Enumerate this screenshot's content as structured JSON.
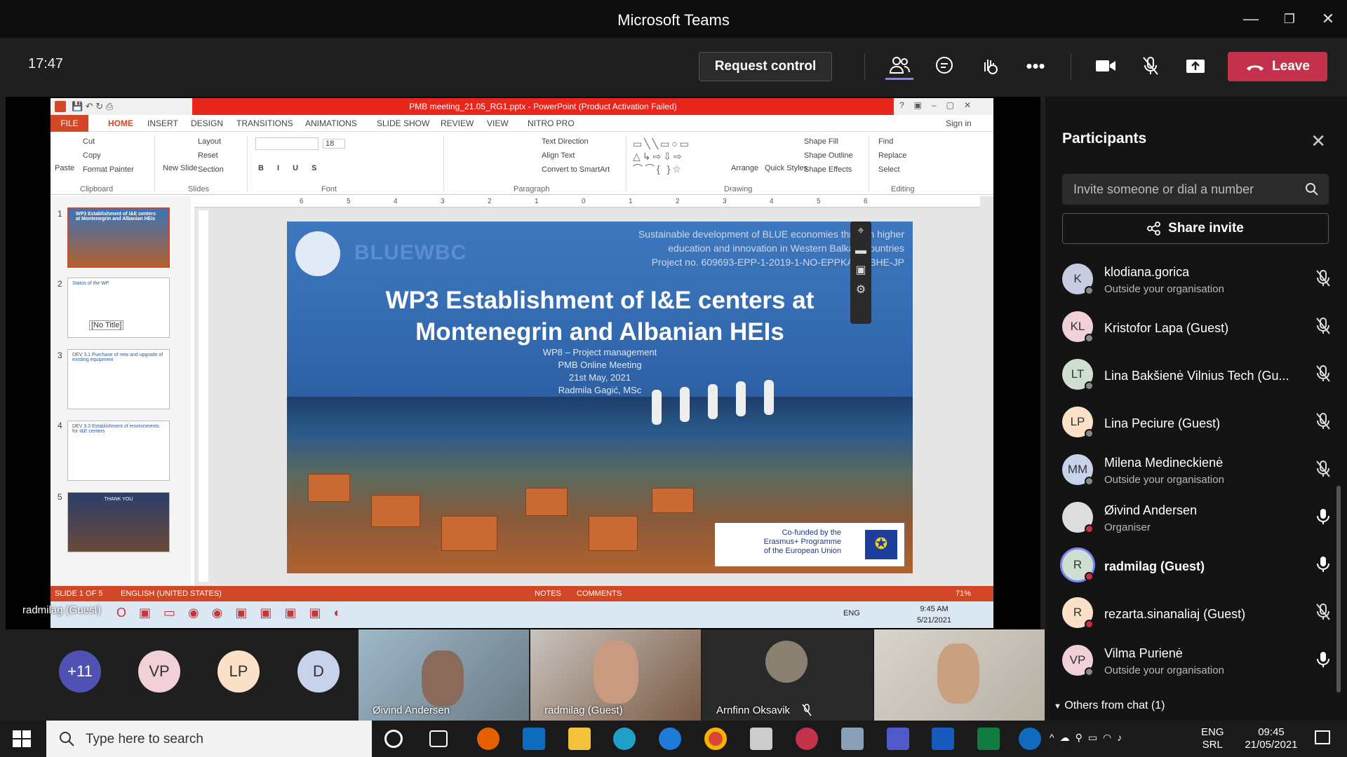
{
  "window": {
    "title": "Microsoft Teams",
    "minimize": "—",
    "maximize": "❐",
    "close": "✕"
  },
  "meeting_bar": {
    "clock": "17:47",
    "request_control": "Request control",
    "leave": "Leave"
  },
  "ppt": {
    "title": "PMB meeting_21.05_RG1.pptx - PowerPoint (Product Activation Failed)",
    "sign_in": "Sign in",
    "tabs": [
      "FILE",
      "HOME",
      "INSERT",
      "DESIGN",
      "TRANSITIONS",
      "ANIMATIONS",
      "SLIDE SHOW",
      "REVIEW",
      "VIEW",
      "NITRO PRO"
    ],
    "clipboard": {
      "paste": "Paste",
      "cut": "Cut",
      "copy": "Copy",
      "format_painter": "Format Painter",
      "group": "Clipboard"
    },
    "slides_group": {
      "new_slide": "New Slide",
      "layout": "Layout",
      "reset": "Reset",
      "section": "Section",
      "group": "Slides"
    },
    "font_group": {
      "size": "18",
      "group": "Font"
    },
    "paragraph_group": {
      "text_direction": "Text Direction",
      "align_text": "Align Text",
      "convert": "Convert to SmartArt",
      "group": "Paragraph"
    },
    "drawing_group": {
      "arrange": "Arrange",
      "quick_styles": "Quick Styles",
      "shape_fill": "Shape Fill",
      "shape_outline": "Shape Outline",
      "shape_effects": "Shape Effects",
      "group": "Drawing"
    },
    "editing_group": {
      "find": "Find",
      "replace": "Replace",
      "select": "Select",
      "group": "Editing"
    },
    "thumbs": [
      {
        "num": "1",
        "caption": "WP3 Establishment of I&E centers at Montenegrin and Albanian HEIs"
      },
      {
        "num": "2",
        "caption": "Status of the WP",
        "tooltip": "[No Title]"
      },
      {
        "num": "3",
        "caption": "DEV 3.1 Purchase of new and upgrade of existing equipment"
      },
      {
        "num": "4",
        "caption": "DEV 3.3 Establishment of environments for I&E centers"
      },
      {
        "num": "5",
        "caption": "THANK YOU"
      }
    ],
    "ruler": [
      "6",
      "5",
      "4",
      "3",
      "2",
      "1",
      "0",
      "1",
      "2",
      "3",
      "4",
      "5",
      "6"
    ],
    "slide": {
      "logo_text": "BLUEWBC",
      "top_right": [
        "Sustainable development of BLUE economies through higher",
        "education and innovation in Western Balkan Countries",
        "Project no. 609693-EPP-1-2019-1-NO-EPPKA2-CBHE-JP"
      ],
      "title_line1": "WP3 Establishment of I&E centers at",
      "title_line2": "Montenegrin and Albanian HEIs",
      "sub": [
        "WP8 – Project management",
        "PMB Online Meeting",
        "21st May, 2021",
        "Radmila Gagić, MSc"
      ],
      "eu": [
        "Co-funded by the",
        "Erasmus+ Programme",
        "of the European Union"
      ]
    },
    "status": {
      "slide": "SLIDE 1 OF 5",
      "lang": "ENGLISH (UNITED STATES)",
      "notes": "NOTES",
      "comments": "COMMENTS",
      "zoom": "71%"
    },
    "vm_taskbar": {
      "lang": "ENG",
      "time": "9:45 AM",
      "date": "5/21/2021"
    }
  },
  "share_label": "radmilag (Guest)",
  "panel": {
    "title": "Participants",
    "invite_placeholder": "Invite someone or dial a number",
    "share_invite": "Share invite",
    "participants": [
      {
        "initials": "K",
        "name": "klodiana.gorica",
        "sub": "Outside your organisation",
        "bg": "#c8cce0",
        "muted": true
      },
      {
        "initials": "KL",
        "name": "Kristofor Lapa (Guest)",
        "sub": "",
        "bg": "#f1d0d6",
        "muted": true
      },
      {
        "initials": "LT",
        "name": "Lina Bakšienė Vilnius Tech (Gu...",
        "sub": "",
        "bg": "#cfe0d2",
        "muted": true
      },
      {
        "initials": "LP",
        "name": "Lina Peciure (Guest)",
        "sub": "",
        "bg": "#fbe1c8",
        "muted": true
      },
      {
        "initials": "MM",
        "name": "Milena Medineckienė",
        "sub": "Outside your organisation",
        "bg": "#c7d3ea",
        "muted": true
      },
      {
        "initials": "",
        "name": "Øivind Andersen",
        "sub": "Organiser",
        "bg": "#ddd",
        "muted": false
      },
      {
        "initials": "R",
        "name": "radmilag (Guest)",
        "sub": "",
        "bg": "#cfe0d2",
        "muted": false
      },
      {
        "initials": "R",
        "name": "rezarta.sinanaliaj (Guest)",
        "sub": "",
        "bg": "#fbe1c8",
        "muted": true
      },
      {
        "initials": "VP",
        "name": "Vilma Purienė",
        "sub": "Outside your organisation",
        "bg": "#f1d0d6",
        "muted": false
      }
    ],
    "others": "Others from chat (1)"
  },
  "gallery": {
    "more": "+11",
    "avatars": [
      {
        "initials": "VP",
        "bg": "#f1d0d6"
      },
      {
        "initials": "LP",
        "bg": "#fbe1c8"
      },
      {
        "initials": "D",
        "bg": "#c7d3ea"
      }
    ],
    "tiles": [
      "Øivind Andersen",
      "radmilag (Guest)",
      "Arnfinn Oksavik",
      ""
    ]
  },
  "taskbar": {
    "search_placeholder": "Type here to search",
    "lang1": "ENG",
    "lang2": "SRL",
    "time": "09:45",
    "date": "21/05/2021"
  }
}
